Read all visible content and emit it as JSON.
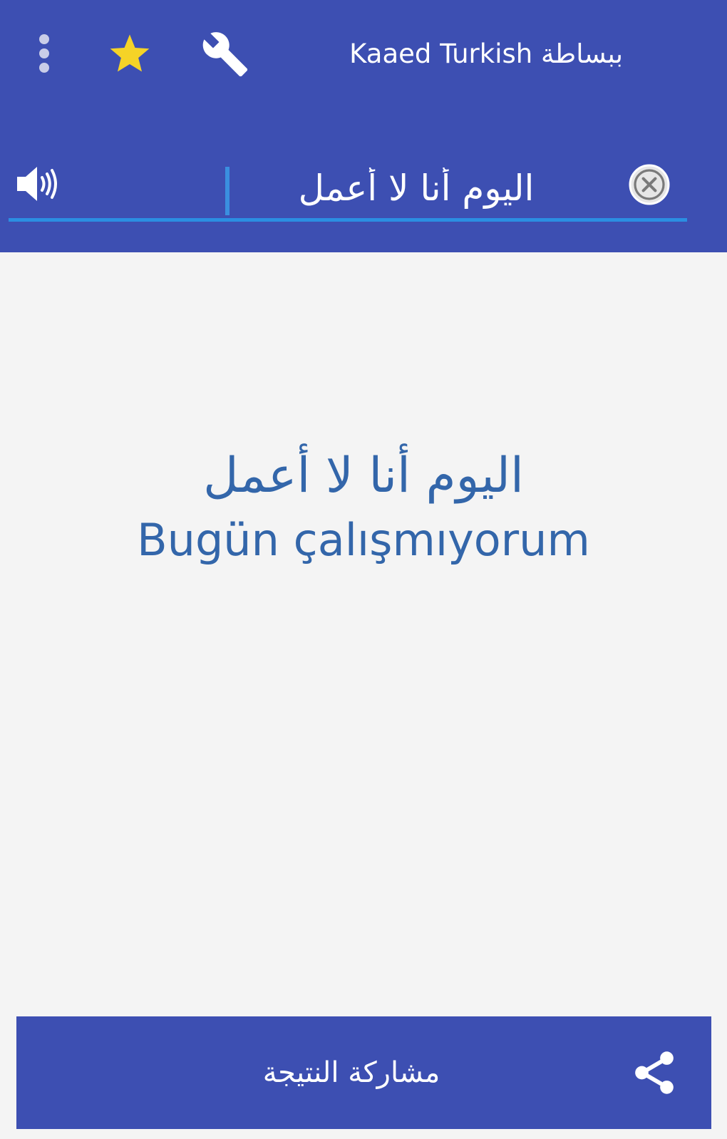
{
  "appbar": {
    "title": "Kaaed Turkish ببساطة",
    "background": "#3d4fb2",
    "icons": {
      "more": "more-vert-icon",
      "favorite": "star-icon",
      "settings": "wrench-icon"
    },
    "star_color": "#f5d327"
  },
  "search": {
    "value": "اليوم أنا لا أعمل",
    "underline_color": "#2b8ee2",
    "icons": {
      "speak": "speaker-icon",
      "clear": "clear-circle-icon"
    }
  },
  "result": {
    "source_text": "اليوم أنا لا أعمل",
    "translation": "Bugün çalışmıyorum",
    "text_color": "#3366aa"
  },
  "share": {
    "label": "مشاركة النتيجة",
    "icon": "share-icon"
  }
}
